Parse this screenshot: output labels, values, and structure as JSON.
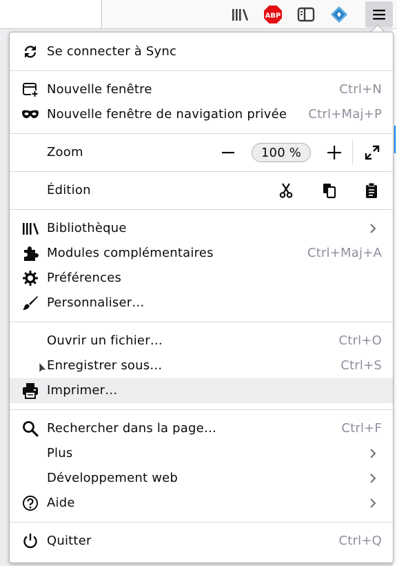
{
  "toolbar": {
    "icons": [
      "library-icon",
      "adblock-plus-icon",
      "sidebar-icon",
      "extension-diamond-icon",
      "hamburger-menu-icon"
    ],
    "abp_text": "ABP"
  },
  "menu": {
    "sync": {
      "label": "Se connecter à Sync",
      "icon": "sync-icon"
    },
    "new_window": {
      "label": "Nouvelle fenêtre",
      "shortcut": "Ctrl+N",
      "icon": "new-window-icon"
    },
    "private_window": {
      "label": "Nouvelle fenêtre de navigation privée",
      "shortcut": "Ctrl+Maj+P",
      "icon": "private-mask-icon"
    },
    "zoom": {
      "label": "Zoom",
      "value": "100 %"
    },
    "edit": {
      "label": "Édition"
    },
    "library": {
      "label": "Bibliothèque",
      "icon": "library-icon"
    },
    "addons": {
      "label": "Modules complémentaires",
      "shortcut": "Ctrl+Maj+A",
      "icon": "puzzle-icon"
    },
    "preferences": {
      "label": "Préférences",
      "icon": "gear-icon"
    },
    "customize": {
      "label": "Personnaliser…",
      "icon": "paintbrush-icon"
    },
    "open_file": {
      "label": "Ouvrir un fichier…",
      "shortcut": "Ctrl+O"
    },
    "save_as": {
      "label": "Enregistrer sous…",
      "shortcut": "Ctrl+S"
    },
    "print": {
      "label": "Imprimer…",
      "icon": "printer-icon"
    },
    "find": {
      "label": "Rechercher dans la page…",
      "shortcut": "Ctrl+F",
      "icon": "search-icon"
    },
    "more": {
      "label": "Plus"
    },
    "webdev": {
      "label": "Développement web"
    },
    "help": {
      "label": "Aide",
      "icon": "help-icon"
    },
    "quit": {
      "label": "Quitter",
      "shortcut": "Ctrl+Q",
      "icon": "power-icon"
    }
  },
  "colors": {
    "accent": "#0a84ff",
    "hover_bg": "#ededf0",
    "shortcut": "#8f8f9d",
    "abp_red": "#e40f12"
  }
}
